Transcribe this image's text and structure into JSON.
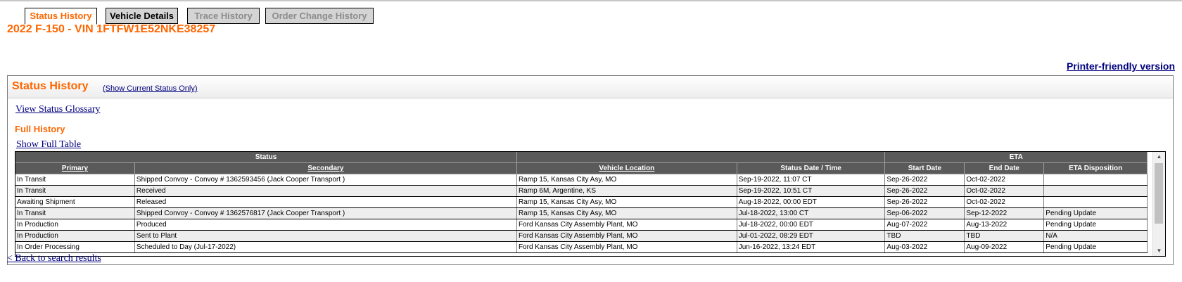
{
  "tabs": [
    {
      "label": "Status History",
      "state": "active"
    },
    {
      "label": "Vehicle Details",
      "state": "enabled"
    },
    {
      "label": "Trace History",
      "state": "disabled"
    },
    {
      "label": "Order Change History",
      "state": "disabled"
    }
  ],
  "vehicle_title": "2022 F-150 - VIN 1FTFW1E52NKE38257",
  "printer_link": "Printer-friendly version",
  "panel": {
    "title": "Status History",
    "show_current": "(Show Current Status Only)",
    "glossary_link": "View Status Glossary",
    "full_history": "Full History",
    "show_table": "Show Full Table"
  },
  "table": {
    "group_headers": {
      "status": "Status",
      "location": "",
      "eta": "ETA"
    },
    "columns": [
      "Primary",
      "Secondary",
      "Vehicle Location",
      "Status Date / Time",
      "Start Date",
      "End Date",
      "ETA Disposition"
    ],
    "rows": [
      [
        "In Transit",
        "Shipped Convoy - Convoy # 1362593456 (Jack Cooper Transport )",
        "Ramp 15, Kansas City Asy, MO",
        "Sep-19-2022, 11:07 CT",
        "Sep-26-2022",
        "Oct-02-2022",
        ""
      ],
      [
        "In Transit",
        "Received",
        "Ramp 6M, Argentine, KS",
        "Sep-19-2022, 10:51 CT",
        "Sep-26-2022",
        "Oct-02-2022",
        ""
      ],
      [
        "Awaiting Shipment",
        "Released",
        "Ramp 15, Kansas City Asy, MO",
        "Aug-18-2022, 00:00 EDT",
        "Sep-26-2022",
        "Oct-02-2022",
        ""
      ],
      [
        "In Transit",
        "Shipped Convoy - Convoy # 1362576817 (Jack Cooper Transport )",
        "Ramp 15, Kansas City Asy, MO",
        "Jul-18-2022, 13:00 CT",
        "Sep-06-2022",
        "Sep-12-2022",
        "Pending Update"
      ],
      [
        "In Production",
        "Produced",
        "Ford Kansas City Assembly Plant, MO",
        "Jul-18-2022, 00:00 EDT",
        "Aug-07-2022",
        "Aug-13-2022",
        "Pending Update"
      ],
      [
        "In Production",
        "Sent to Plant",
        "Ford Kansas City Assembly Plant, MO",
        "Jul-01-2022, 08:29 EDT",
        "TBD",
        "TBD",
        "N/A"
      ],
      [
        "In Order Processing",
        "Scheduled to Day (Jul-17-2022)",
        "Ford Kansas City Assembly Plant, MO",
        "Jun-16-2022, 13:24 EDT",
        "Aug-03-2022",
        "Aug-09-2022",
        "Pending Update"
      ]
    ]
  },
  "back_link": "< Back to search results",
  "colors": {
    "accent": "#ff6600",
    "link": "#000080",
    "header_bg": "#5a5a5a"
  }
}
